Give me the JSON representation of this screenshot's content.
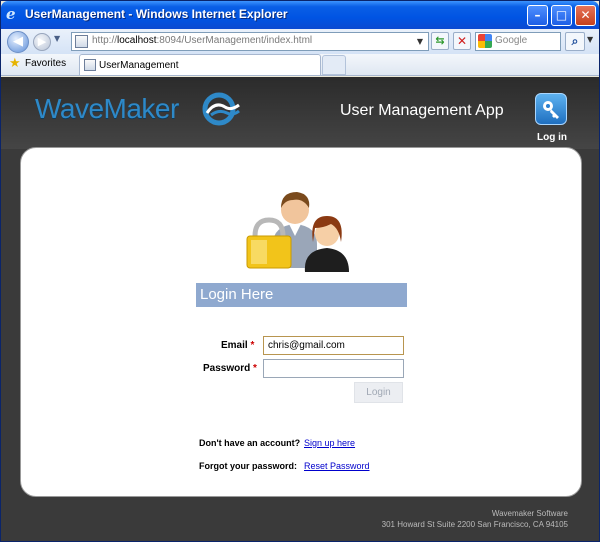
{
  "window": {
    "title": "UserManagement - Windows Internet Explorer",
    "icon": "ie-icon",
    "controls": [
      "minimize-button",
      "maximize-button",
      "close-button"
    ]
  },
  "browser": {
    "address_prefix": "http://",
    "address_host": "localhost",
    "address_rest": ":8094/UserManagement/index.html",
    "search_placeholder": "Google",
    "favorites_label": "Favorites",
    "tab_label": "UserManagement"
  },
  "app": {
    "logo_text": "WaveMaker",
    "title": "User Management App",
    "login_icon_label": "Log in",
    "brand_color": "#2e89c8"
  },
  "login": {
    "heading": "Login Here",
    "email_label": "Email",
    "email_value": "chris@gmail.com",
    "password_label": "Password",
    "password_value": "",
    "required_marker": "*",
    "button_label": "Login",
    "no_account_text": "Don't have an account?",
    "signup_link": "Sign up here",
    "forgot_text": "Forgot your password:",
    "reset_link": "Reset Password"
  },
  "footer": {
    "company": "Wavemaker Software",
    "address": "301 Howard St Suite 2200 San Francisco, CA 94105"
  }
}
